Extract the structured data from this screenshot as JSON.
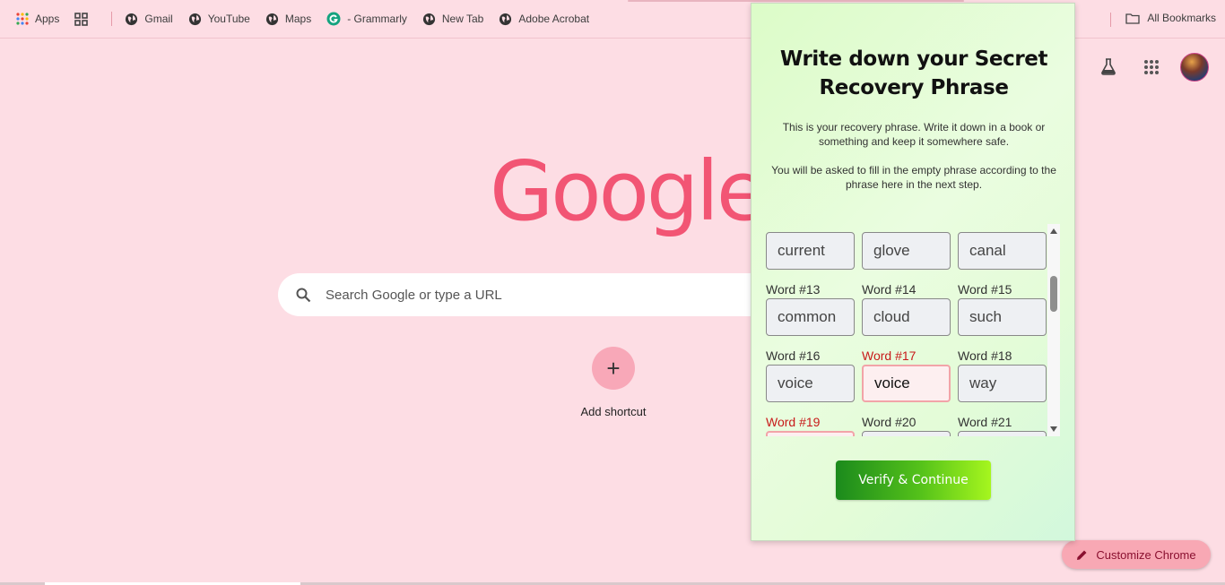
{
  "bookmarks_bar": {
    "items": [
      {
        "label": "Apps",
        "icon": "apps-grid-icon"
      },
      {
        "label": "",
        "icon": "tab-groups-icon"
      },
      {
        "label": "Gmail",
        "icon": "globe-icon"
      },
      {
        "label": "YouTube",
        "icon": "globe-icon"
      },
      {
        "label": "Maps",
        "icon": "globe-icon"
      },
      {
        "label": "- Grammarly",
        "icon": "grammarly-icon"
      },
      {
        "label": "New Tab",
        "icon": "globe-icon"
      },
      {
        "label": "Adobe Acrobat",
        "icon": "globe-icon"
      }
    ],
    "all_bookmarks": "All Bookmarks"
  },
  "newtab": {
    "logo": "Google",
    "search_placeholder": "Search Google or type a URL",
    "add_shortcut": "Add shortcut",
    "customize": "Customize Chrome",
    "logo_color": "#f25574",
    "background": "#fdddE4"
  },
  "popup": {
    "title": "Write down your Secret Recovery Phrase",
    "para1": "This is your recovery phrase. Write it down in a book or something and keep it somewhere safe.",
    "para2": "You will be asked to fill in the empty phrase according to the phrase here in the next step.",
    "words": [
      {
        "label": "",
        "value": "current",
        "error": false
      },
      {
        "label": "",
        "value": "glove",
        "error": false
      },
      {
        "label": "",
        "value": "canal",
        "error": false
      },
      {
        "label": "Word #13",
        "value": "common",
        "error": false
      },
      {
        "label": "Word #14",
        "value": "cloud",
        "error": false
      },
      {
        "label": "Word #15",
        "value": "such",
        "error": false
      },
      {
        "label": "Word #16",
        "value": "voice",
        "error": false
      },
      {
        "label": "Word #17",
        "value": "voice",
        "error": true
      },
      {
        "label": "Word #18",
        "value": "way",
        "error": false
      },
      {
        "label": "Word #19",
        "value": "",
        "error": true
      },
      {
        "label": "Word #20",
        "value": "",
        "error": false
      },
      {
        "label": "Word #21",
        "value": "",
        "error": false
      }
    ],
    "verify_button": "Verify & Continue"
  }
}
